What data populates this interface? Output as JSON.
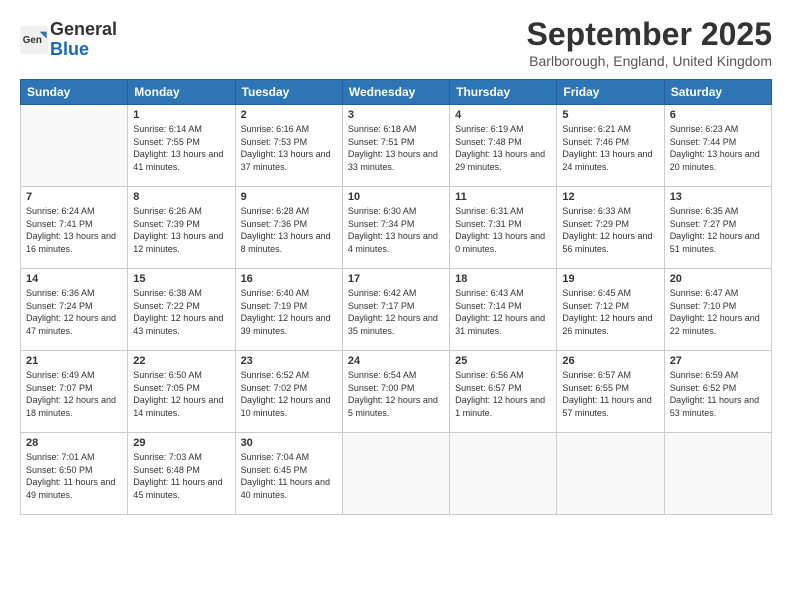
{
  "header": {
    "logo_general": "General",
    "logo_blue": "Blue",
    "month_title": "September 2025",
    "location": "Barlborough, England, United Kingdom"
  },
  "weekdays": [
    "Sunday",
    "Monday",
    "Tuesday",
    "Wednesday",
    "Thursday",
    "Friday",
    "Saturday"
  ],
  "weeks": [
    [
      {
        "num": "",
        "empty": true
      },
      {
        "num": "1",
        "sunrise": "6:14 AM",
        "sunset": "7:55 PM",
        "daylight": "13 hours and 41 minutes."
      },
      {
        "num": "2",
        "sunrise": "6:16 AM",
        "sunset": "7:53 PM",
        "daylight": "13 hours and 37 minutes."
      },
      {
        "num": "3",
        "sunrise": "6:18 AM",
        "sunset": "7:51 PM",
        "daylight": "13 hours and 33 minutes."
      },
      {
        "num": "4",
        "sunrise": "6:19 AM",
        "sunset": "7:48 PM",
        "daylight": "13 hours and 29 minutes."
      },
      {
        "num": "5",
        "sunrise": "6:21 AM",
        "sunset": "7:46 PM",
        "daylight": "13 hours and 24 minutes."
      },
      {
        "num": "6",
        "sunrise": "6:23 AM",
        "sunset": "7:44 PM",
        "daylight": "13 hours and 20 minutes."
      }
    ],
    [
      {
        "num": "7",
        "sunrise": "6:24 AM",
        "sunset": "7:41 PM",
        "daylight": "13 hours and 16 minutes."
      },
      {
        "num": "8",
        "sunrise": "6:26 AM",
        "sunset": "7:39 PM",
        "daylight": "13 hours and 12 minutes."
      },
      {
        "num": "9",
        "sunrise": "6:28 AM",
        "sunset": "7:36 PM",
        "daylight": "13 hours and 8 minutes."
      },
      {
        "num": "10",
        "sunrise": "6:30 AM",
        "sunset": "7:34 PM",
        "daylight": "13 hours and 4 minutes."
      },
      {
        "num": "11",
        "sunrise": "6:31 AM",
        "sunset": "7:31 PM",
        "daylight": "13 hours and 0 minutes."
      },
      {
        "num": "12",
        "sunrise": "6:33 AM",
        "sunset": "7:29 PM",
        "daylight": "12 hours and 56 minutes."
      },
      {
        "num": "13",
        "sunrise": "6:35 AM",
        "sunset": "7:27 PM",
        "daylight": "12 hours and 51 minutes."
      }
    ],
    [
      {
        "num": "14",
        "sunrise": "6:36 AM",
        "sunset": "7:24 PM",
        "daylight": "12 hours and 47 minutes."
      },
      {
        "num": "15",
        "sunrise": "6:38 AM",
        "sunset": "7:22 PM",
        "daylight": "12 hours and 43 minutes."
      },
      {
        "num": "16",
        "sunrise": "6:40 AM",
        "sunset": "7:19 PM",
        "daylight": "12 hours and 39 minutes."
      },
      {
        "num": "17",
        "sunrise": "6:42 AM",
        "sunset": "7:17 PM",
        "daylight": "12 hours and 35 minutes."
      },
      {
        "num": "18",
        "sunrise": "6:43 AM",
        "sunset": "7:14 PM",
        "daylight": "12 hours and 31 minutes."
      },
      {
        "num": "19",
        "sunrise": "6:45 AM",
        "sunset": "7:12 PM",
        "daylight": "12 hours and 26 minutes."
      },
      {
        "num": "20",
        "sunrise": "6:47 AM",
        "sunset": "7:10 PM",
        "daylight": "12 hours and 22 minutes."
      }
    ],
    [
      {
        "num": "21",
        "sunrise": "6:49 AM",
        "sunset": "7:07 PM",
        "daylight": "12 hours and 18 minutes."
      },
      {
        "num": "22",
        "sunrise": "6:50 AM",
        "sunset": "7:05 PM",
        "daylight": "12 hours and 14 minutes."
      },
      {
        "num": "23",
        "sunrise": "6:52 AM",
        "sunset": "7:02 PM",
        "daylight": "12 hours and 10 minutes."
      },
      {
        "num": "24",
        "sunrise": "6:54 AM",
        "sunset": "7:00 PM",
        "daylight": "12 hours and 5 minutes."
      },
      {
        "num": "25",
        "sunrise": "6:56 AM",
        "sunset": "6:57 PM",
        "daylight": "12 hours and 1 minute."
      },
      {
        "num": "26",
        "sunrise": "6:57 AM",
        "sunset": "6:55 PM",
        "daylight": "11 hours and 57 minutes."
      },
      {
        "num": "27",
        "sunrise": "6:59 AM",
        "sunset": "6:52 PM",
        "daylight": "11 hours and 53 minutes."
      }
    ],
    [
      {
        "num": "28",
        "sunrise": "7:01 AM",
        "sunset": "6:50 PM",
        "daylight": "11 hours and 49 minutes."
      },
      {
        "num": "29",
        "sunrise": "7:03 AM",
        "sunset": "6:48 PM",
        "daylight": "11 hours and 45 minutes."
      },
      {
        "num": "30",
        "sunrise": "7:04 AM",
        "sunset": "6:45 PM",
        "daylight": "11 hours and 40 minutes."
      },
      {
        "num": "",
        "empty": true
      },
      {
        "num": "",
        "empty": true
      },
      {
        "num": "",
        "empty": true
      },
      {
        "num": "",
        "empty": true
      }
    ]
  ]
}
